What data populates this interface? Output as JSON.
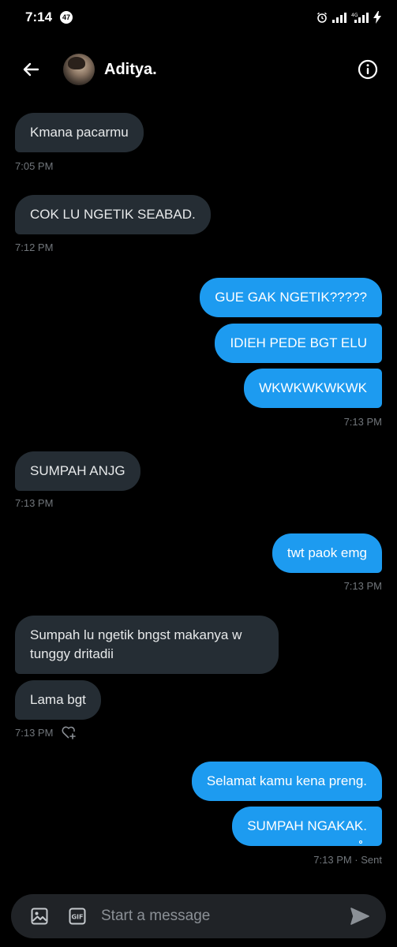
{
  "status_bar": {
    "time": "7:14",
    "notification_count": "47"
  },
  "header": {
    "contact_name": "Aditya."
  },
  "messages": [
    {
      "direction": "in",
      "text": "Kmana pacarmu"
    },
    {
      "direction": "in",
      "text": "COK LU NGETIK SEABAD."
    },
    {
      "direction": "out",
      "text": "GUE GAK NGETIK?????"
    },
    {
      "direction": "out",
      "text": "IDIEH PEDE BGT ELU"
    },
    {
      "direction": "out",
      "text": "WKWKWKWKWK"
    },
    {
      "direction": "in",
      "text": "SUMPAH ANJG"
    },
    {
      "direction": "out",
      "text": "twt paok emg"
    },
    {
      "direction": "in",
      "text": "Sumpah lu ngetik bngst makanya w tunggy dritadii"
    },
    {
      "direction": "in",
      "text": "Lama bgt"
    },
    {
      "direction": "out",
      "text": "Selamat kamu kena preng."
    },
    {
      "direction": "out",
      "text": "SUMPAH NGAKAK."
    }
  ],
  "timestamps": [
    "7:05 PM",
    "7:12 PM",
    "7:13 PM",
    "7:13 PM",
    "7:13 PM",
    "7:13 PM",
    "7:13 PM · Sent"
  ],
  "composer": {
    "placeholder": "Start a message",
    "gif_label": "GIF"
  },
  "colors": {
    "background": "#000000",
    "incoming_bubble": "#252d34",
    "outgoing_bubble": "#1d9bf0",
    "timestamp": "#71767b",
    "composer_bg": "#202327"
  },
  "icons": {
    "back": "arrow-left-icon",
    "info": "info-circle-icon",
    "image": "image-icon",
    "gif": "gif-icon",
    "send": "send-icon",
    "react": "heart-plus-icon"
  }
}
